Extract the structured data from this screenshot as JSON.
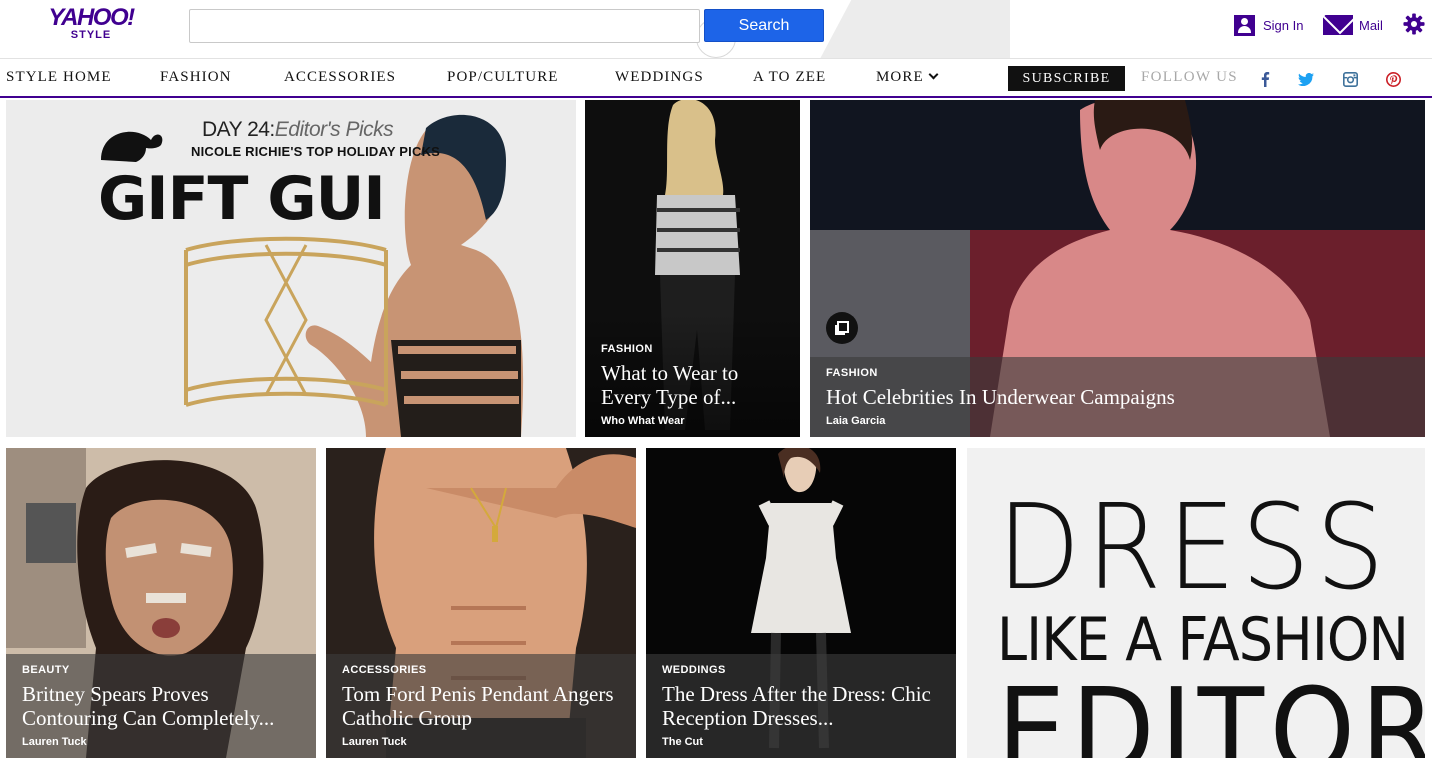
{
  "header": {
    "logo_brand": "YAHOO!",
    "logo_sub": "STYLE",
    "search_placeholder": "",
    "search_button": "Search",
    "sign_in": "Sign In",
    "mail": "Mail"
  },
  "nav": {
    "items": [
      "STYLE HOME",
      "FASHION",
      "ACCESSORIES",
      "POP/CULTURE",
      "WEDDINGS",
      "A TO ZEE",
      "MORE"
    ],
    "subscribe": "SUBSCRIBE",
    "follow": "FOLLOW US"
  },
  "colors": {
    "brand": "#400090",
    "search_button": "#1d64e8"
  },
  "icons": [
    "user-icon",
    "mail-icon",
    "gear-icon",
    "facebook-icon",
    "twitter-icon",
    "instagram-icon",
    "pinterest-icon",
    "gallery-icon"
  ],
  "promo": {
    "day": "DAY 24:",
    "day_italic": "Editor's Picks",
    "subtitle": "NICOLE RICHIE'S TOP HOLIDAY PICKS",
    "gift": "GIFT GUI"
  },
  "tiles": [
    {
      "category": "FASHION",
      "headline": "What to Wear to Every Type of...",
      "author": "Who What Wear"
    },
    {
      "category": "FASHION",
      "headline": "Hot Celebrities In Underwear Campaigns",
      "author": "Laia Garcia"
    },
    {
      "category": "BEAUTY",
      "headline": "Britney Spears Proves Contouring Can Completely...",
      "author": "Lauren Tuck"
    },
    {
      "category": "ACCESSORIES",
      "headline": "Tom Ford Penis Pendant Angers Catholic Group",
      "author": "Lauren Tuck"
    },
    {
      "category": "WEDDINGS",
      "headline": "The Dress After the Dress: Chic Reception Dresses...",
      "author": "The Cut"
    }
  ],
  "dress_promo": {
    "line1": "DRESS",
    "line2": "LIKE A FASHION",
    "line3": "EDITOR"
  }
}
